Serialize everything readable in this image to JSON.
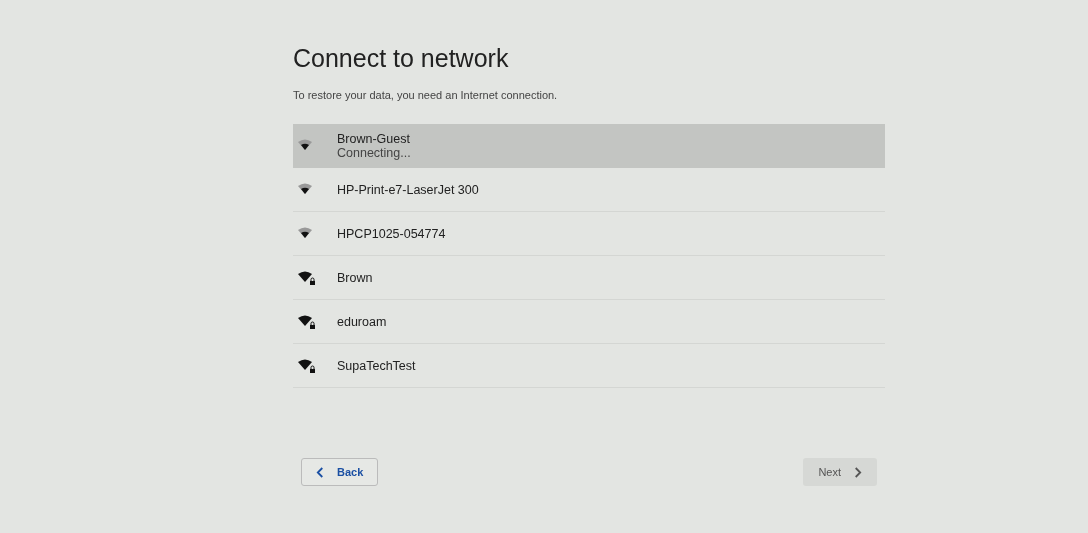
{
  "title": "Connect to network",
  "subtitle": "To restore your data, you need an Internet connection.",
  "networks": [
    {
      "name": "Brown-Guest",
      "status": "Connecting...",
      "secured": false,
      "selected": true
    },
    {
      "name": "HP-Print-e7-LaserJet 300",
      "secured": false,
      "selected": false
    },
    {
      "name": "HPCP1025-054774",
      "secured": false,
      "selected": false
    },
    {
      "name": "Brown",
      "secured": true,
      "selected": false
    },
    {
      "name": "eduroam",
      "secured": true,
      "selected": false
    },
    {
      "name": "SupaTechTest",
      "secured": true,
      "selected": false
    }
  ],
  "back_button": {
    "label": "Back",
    "disabled": false
  },
  "next_button": {
    "label": "Next",
    "disabled": true
  }
}
